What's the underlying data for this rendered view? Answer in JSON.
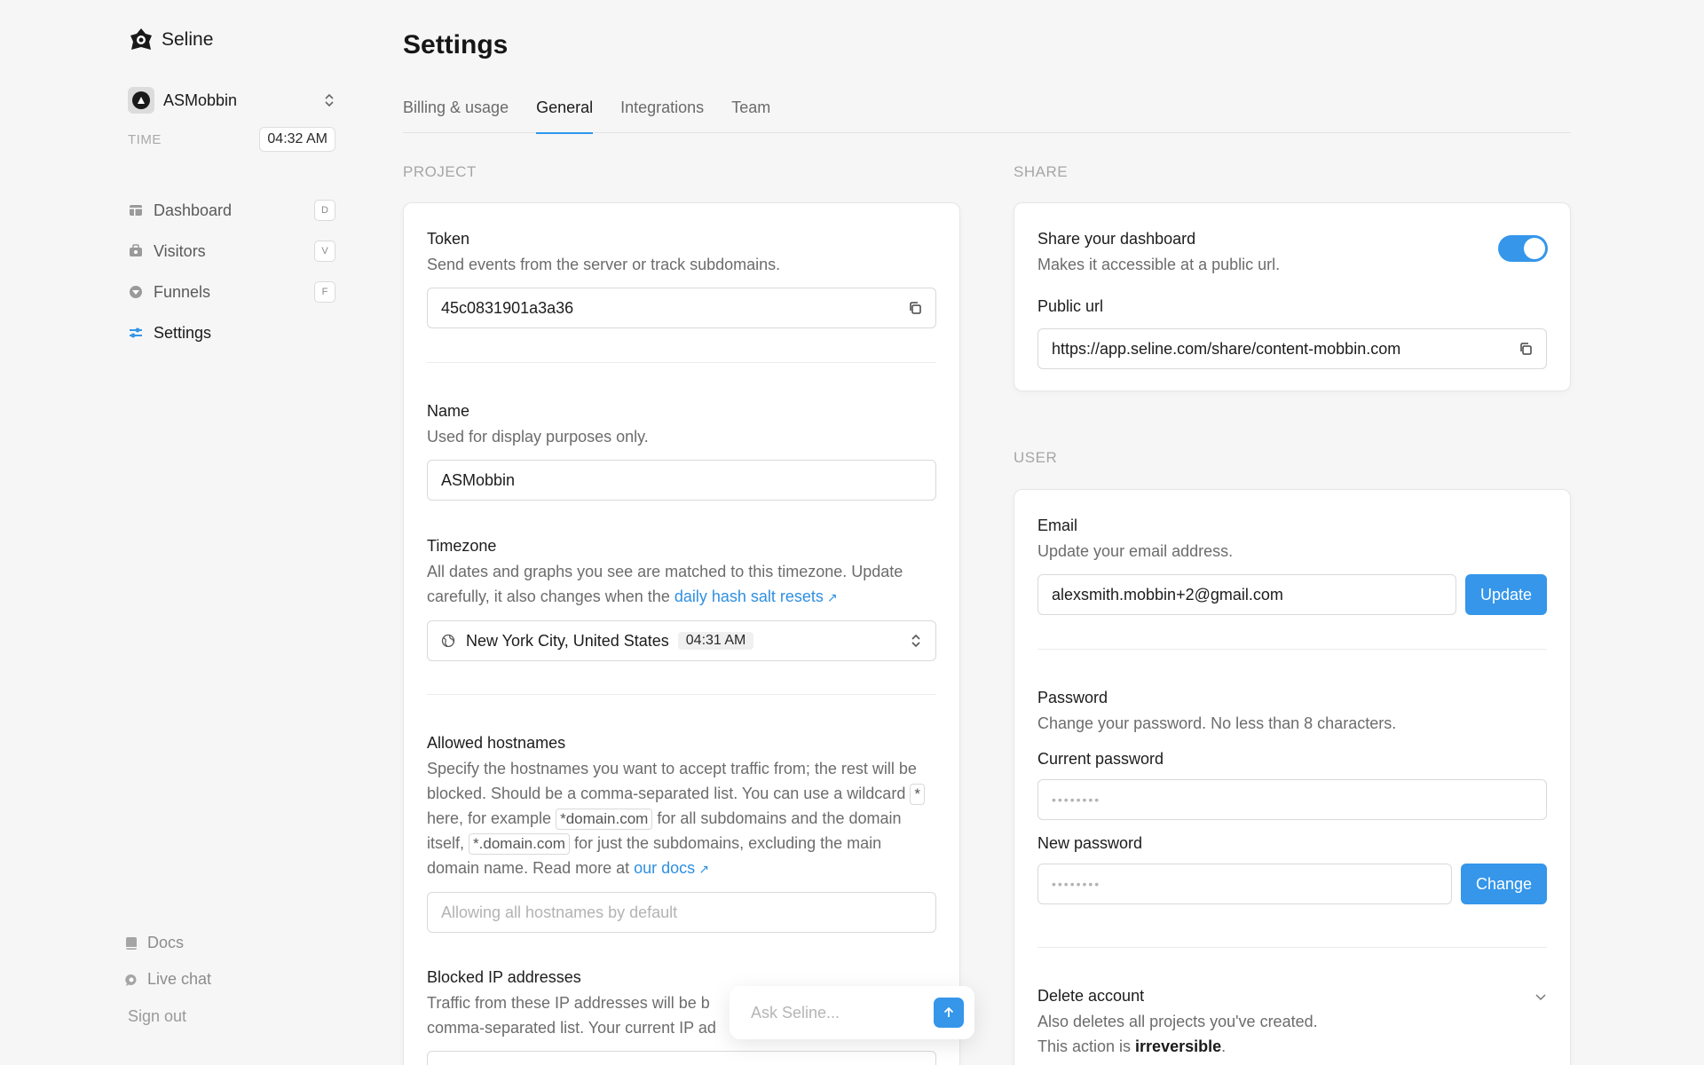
{
  "brand": {
    "name": "Seline"
  },
  "project": {
    "name": "ASMobbin"
  },
  "time": {
    "label": "TIME",
    "value": "04:32 AM"
  },
  "nav": [
    {
      "label": "Dashboard",
      "key": "D",
      "icon": "dashboard-icon"
    },
    {
      "label": "Visitors",
      "key": "V",
      "icon": "visitors-icon"
    },
    {
      "label": "Funnels",
      "key": "F",
      "icon": "funnels-icon"
    },
    {
      "label": "Settings",
      "key": "",
      "icon": "settings-icon",
      "active": true
    }
  ],
  "bottom_links": [
    {
      "label": "Docs",
      "icon": "book-icon"
    },
    {
      "label": "Live chat",
      "icon": "chat-icon"
    }
  ],
  "signout": "Sign out",
  "page_title": "Settings",
  "tabs": [
    {
      "label": "Billing & usage"
    },
    {
      "label": "General",
      "active": true
    },
    {
      "label": "Integrations"
    },
    {
      "label": "Team"
    }
  ],
  "project_section": {
    "label": "PROJECT",
    "token": {
      "title": "Token",
      "desc": "Send events from the server or track subdomains.",
      "value": "45c0831901a3a36"
    },
    "name": {
      "title": "Name",
      "desc": "Used for display purposes only.",
      "value": "ASMobbin"
    },
    "timezone": {
      "title": "Timezone",
      "desc": "All dates and graphs you see are matched to this timezone. Update carefully, it also changes when the ",
      "link": "daily hash salt resets",
      "value": "New York City, United States",
      "time": "04:31 AM"
    },
    "hostnames": {
      "title": "Allowed hostnames",
      "desc_1": "Specify the hostnames you want to accept traffic from; the rest will be blocked. Should be a comma-separated list. You can use a wildcard",
      "wildcard": "*",
      "desc_2": "here, for example",
      "example_1": "*domain.com",
      "desc_3": "for all subdomains and the domain itself,",
      "example_2": "*.domain.com",
      "desc_4": "for just the subdomains, excluding the main domain name. Read more at",
      "link": "our docs",
      "placeholder": "Allowing all hostnames by default"
    },
    "blocked_ips": {
      "title": "Blocked IP addresses",
      "desc": "Traffic from these IP addresses will be b",
      "desc_line2": "comma-separated list. Your current IP ad"
    }
  },
  "share_section": {
    "label": "SHARE",
    "title": "Share your dashboard",
    "desc": "Makes it accessible at a public url.",
    "enabled": true,
    "url_label": "Public url",
    "url": "https://app.seline.com/share/content-mobbin.com"
  },
  "user_section": {
    "label": "USER",
    "email": {
      "title": "Email",
      "desc": "Update your email address.",
      "value": "alexsmith.mobbin+2@gmail.com",
      "button": "Update"
    },
    "password": {
      "title": "Password",
      "desc": "Change your password. No less than 8 characters.",
      "current_label": "Current password",
      "current_placeholder": "••••••••",
      "new_label": "New password",
      "new_placeholder": "••••••••",
      "button": "Change"
    },
    "delete": {
      "title": "Delete account",
      "desc": "Also deletes all projects you've created.",
      "desc2_prefix": "This action is ",
      "desc2_bold": "irreversible",
      "desc2_suffix": "."
    }
  },
  "ask": {
    "placeholder": "Ask Seline..."
  },
  "colors": {
    "accent": "#3596ea",
    "link": "#2f8fe0"
  }
}
